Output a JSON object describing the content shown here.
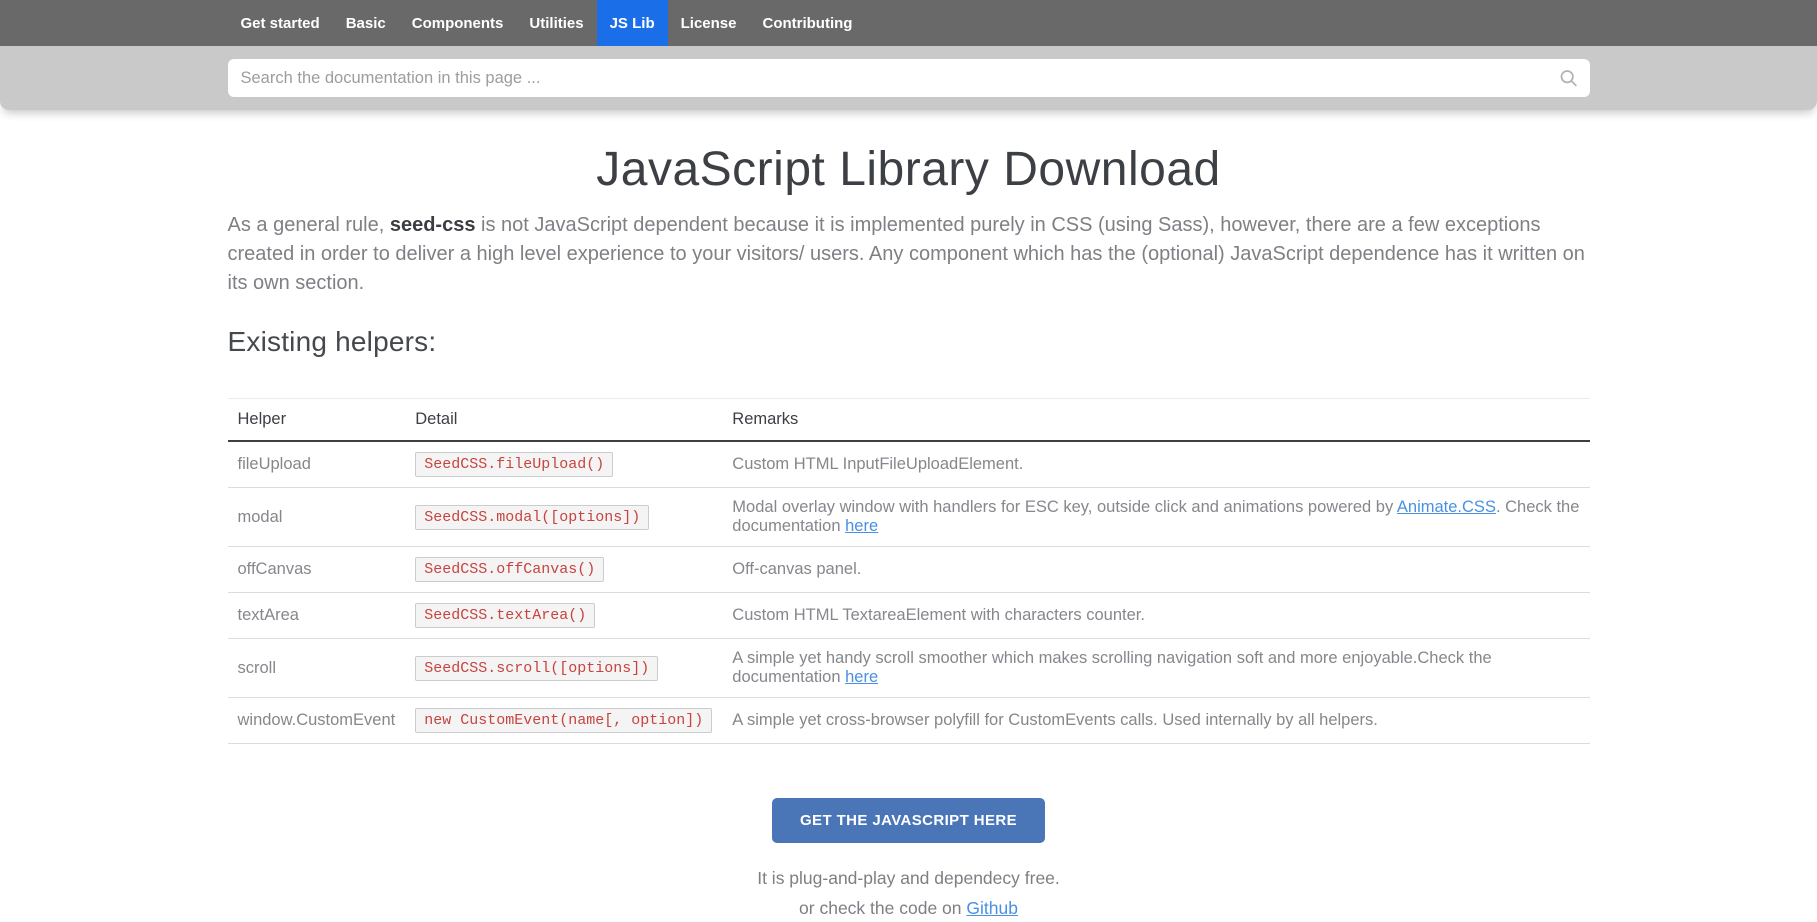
{
  "nav": {
    "items": [
      {
        "label": "Get started",
        "active": false
      },
      {
        "label": "Basic",
        "active": false
      },
      {
        "label": "Components",
        "active": false
      },
      {
        "label": "Utilities",
        "active": false
      },
      {
        "label": "JS Lib",
        "active": true
      },
      {
        "label": "License",
        "active": false
      },
      {
        "label": "Contributing",
        "active": false
      }
    ]
  },
  "search": {
    "placeholder": "Search the documentation in this page ..."
  },
  "page": {
    "title": "JavaScript Library Download",
    "intro": {
      "prefix": "As a general rule, ",
      "bold": "seed-css",
      "suffix": " is not JavaScript dependent because it is implemented purely in CSS (using Sass), however, there are a few exceptions created in order to deliver a high level experience to your visitors/ users. Any component which has the (optional) JavaScript dependence has it written on its own section."
    },
    "section_heading": "Existing helpers:"
  },
  "table": {
    "headers": [
      "Helper",
      "Detail",
      "Remarks"
    ],
    "rows": [
      {
        "helper": "fileUpload",
        "detail": "SeedCSS.fileUpload()",
        "remarks": [
          {
            "text": "Custom HTML InputFileUploadElement."
          }
        ]
      },
      {
        "helper": "modal",
        "detail": "SeedCSS.modal([options])",
        "remarks": [
          {
            "text": "Modal overlay window with handlers for ESC key, outside click and animations powered by "
          },
          {
            "text": "Animate.CSS",
            "link": true
          },
          {
            "text": ". Check the documentation "
          },
          {
            "text": "here",
            "link": true
          }
        ]
      },
      {
        "helper": "offCanvas",
        "detail": "SeedCSS.offCanvas()",
        "remarks": [
          {
            "text": "Off-canvas panel."
          }
        ]
      },
      {
        "helper": "textArea",
        "detail": "SeedCSS.textArea()",
        "remarks": [
          {
            "text": "Custom HTML TextareaElement with characters counter."
          }
        ]
      },
      {
        "helper": "scroll",
        "detail": "SeedCSS.scroll([options])",
        "remarks": [
          {
            "text": "A simple yet handy scroll smoother which makes scrolling navigation soft and more enjoyable.Check the documentation "
          },
          {
            "text": "here",
            "link": true
          }
        ]
      },
      {
        "helper": "window.CustomEvent",
        "detail": "new CustomEvent(name[, option])",
        "remarks": [
          {
            "text": "A simple yet cross-browser polyfill for CustomEvents calls. Used internally by all helpers."
          }
        ]
      }
    ]
  },
  "cta": {
    "button_label": "GET THE JAVASCRIPT HERE",
    "line1": "It is plug-and-play and dependecy free.",
    "line2_prefix": "or check the code on ",
    "line2_link": "Github"
  },
  "colors": {
    "nav_bg": "#696969",
    "nav_active": "#1a6fe8",
    "band_bg": "#c9c9c9",
    "code_red": "#c7443f",
    "link_blue": "#4a90e2",
    "button_bg": "#4a76b8"
  }
}
